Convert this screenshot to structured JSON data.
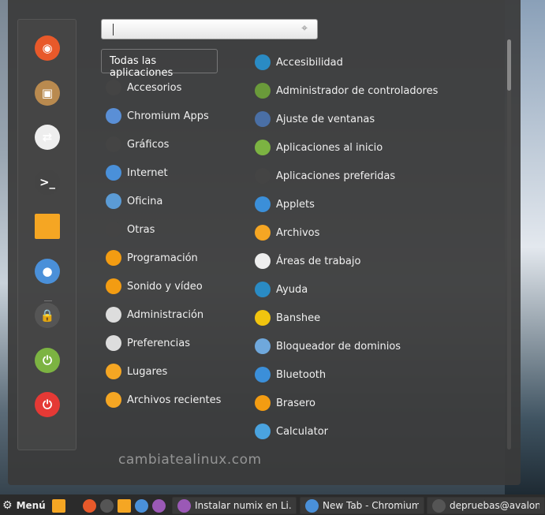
{
  "search": {
    "placeholder": "",
    "value": ""
  },
  "all_apps_label": "Todas las aplicaciones",
  "favorites": [
    {
      "name": "firefox",
      "color": "#e8592a",
      "glyph": "◉"
    },
    {
      "name": "package",
      "color": "#b98a4f",
      "glyph": "▣"
    },
    {
      "name": "settings-toggle",
      "color": "#eee",
      "glyph": "⇄"
    },
    {
      "name": "terminal",
      "color": "#444",
      "glyph": ">_"
    },
    {
      "name": "files",
      "color": "#f5a623",
      "glyph": ""
    },
    {
      "name": "chromium",
      "color": "#4a90d9",
      "glyph": "●"
    },
    {
      "name": "lock-screen",
      "color": "#555",
      "glyph": "🔒"
    },
    {
      "name": "logout",
      "color": "#7cb342",
      "glyph": "⏻"
    },
    {
      "name": "shutdown",
      "color": "#e53935",
      "glyph": "⏻"
    }
  ],
  "categories": [
    {
      "label": "Accesorios",
      "color": "#444"
    },
    {
      "label": "Chromium Apps",
      "color": "#5a8fd6"
    },
    {
      "label": "Gráficos",
      "color": "#444"
    },
    {
      "label": "Internet",
      "color": "#4a90d9"
    },
    {
      "label": "Oficina",
      "color": "#5b9bd5"
    },
    {
      "label": "Otras",
      "color": "#444"
    },
    {
      "label": "Programación",
      "color": "#f39c12"
    },
    {
      "label": "Sonido y vídeo",
      "color": "#f39c12"
    },
    {
      "label": "Administración",
      "color": "#ddd"
    },
    {
      "label": "Preferencias",
      "color": "#ddd"
    },
    {
      "label": "Lugares",
      "color": "#f5a623"
    },
    {
      "label": "Archivos recientes",
      "color": "#f5a623"
    }
  ],
  "apps": [
    {
      "label": "Accesibilidad",
      "color": "#2a8bc4"
    },
    {
      "label": "Administrador de controladores",
      "color": "#6a9a3a"
    },
    {
      "label": "Ajuste de ventanas",
      "color": "#4a6fa5"
    },
    {
      "label": "Aplicaciones al inicio",
      "color": "#7cb342"
    },
    {
      "label": "Aplicaciones preferidas",
      "color": "#444"
    },
    {
      "label": "Applets",
      "color": "#3b8fd9"
    },
    {
      "label": "Archivos",
      "color": "#f5a623"
    },
    {
      "label": "Áreas de trabajo",
      "color": "#eee"
    },
    {
      "label": "Ayuda",
      "color": "#2a8bc4"
    },
    {
      "label": "Banshee",
      "color": "#f1c40f"
    },
    {
      "label": "Bloqueador de dominios",
      "color": "#6fa8dc"
    },
    {
      "label": "Bluetooth",
      "color": "#3b8fd9"
    },
    {
      "label": "Brasero",
      "color": "#f39c12"
    },
    {
      "label": "Calculator",
      "color": "#4aa3df"
    }
  ],
  "watermark": "cambiatealinux.com",
  "taskbar": {
    "menu_label": "Menú",
    "windows": [
      {
        "label": "Instalar numix en Li...",
        "color": "#9b59b6"
      },
      {
        "label": "New Tab - Chromium",
        "color": "#4a90d9"
      },
      {
        "label": "depruebas@avalon: ~",
        "color": "#555"
      }
    ]
  }
}
